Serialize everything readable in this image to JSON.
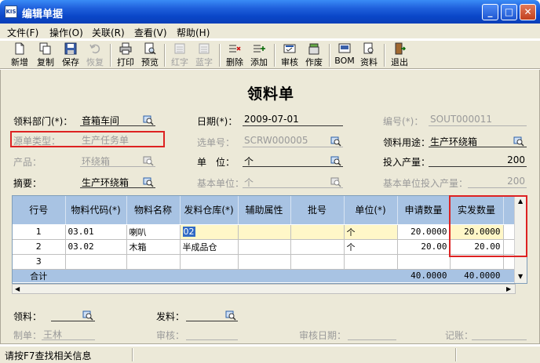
{
  "window": {
    "title": "编辑单据",
    "icon_text": "KIS",
    "buttons": [
      "minimize-icon",
      "maximize-icon",
      "close-icon"
    ]
  },
  "menu": [
    "文件(F)",
    "操作(O)",
    "关联(R)",
    "查看(V)",
    "帮助(H)"
  ],
  "toolbar": {
    "new": "新增",
    "copy": "复制",
    "save": "保存",
    "restore": "恢复",
    "print": "打印",
    "preview": "预览",
    "red": "红字",
    "blue": "蓝字",
    "delete": "删除",
    "add": "添加",
    "audit": "审核",
    "void": "作废",
    "bom": "BOM",
    "material": "资料",
    "exit": "退出"
  },
  "doc": {
    "title": "领料单",
    "dept_label": "领料部门(*)：",
    "dept_value": "音箱车间",
    "date_label": "日期(*)：",
    "date_value": "2009-07-01",
    "number_label": "编号(*)：",
    "number_value": "SOUT000011",
    "source_type_label": "源单类型：",
    "source_type_value": "生产任务单",
    "select_no_label": "选单号：",
    "select_no_value": "SCRW000005",
    "use_label": "领料用途：",
    "use_value": "生产环绕箱",
    "product_label": "产品：",
    "product_value": "环绕箱",
    "unit_label": "单　位：",
    "unit_value": "个",
    "input_qty_label": "投入产量：",
    "input_qty_value": "200",
    "summary_label": "摘要：",
    "summary_value": "生产环绕箱",
    "base_unit_label": "基本单位：",
    "base_unit_value": "个",
    "base_input_label": "基本单位投入产量：",
    "base_input_value": "200"
  },
  "grid": {
    "headers": [
      "行号",
      "物料代码(*)",
      "物料名称",
      "发料仓库(*)",
      "辅助属性",
      "批号",
      "单位(*)",
      "申请数量",
      "实发数量"
    ],
    "rows": [
      {
        "no": "1",
        "code": "03.01",
        "name": "喇叭",
        "warehouse": "02",
        "unit": "个",
        "req": "20.0000",
        "actual": "20.0000"
      },
      {
        "no": "2",
        "code": "03.02",
        "name": "木箱",
        "warehouse": "半成品仓",
        "unit": "个",
        "req": "20.00",
        "actual": "20.00"
      },
      {
        "no": "3",
        "code": "",
        "name": "",
        "warehouse": "",
        "unit": "",
        "req": "",
        "actual": ""
      }
    ],
    "total_label": "合计",
    "total_req": "40.0000",
    "total_actual": "40.0000"
  },
  "footer": {
    "picker_label": "领料：",
    "picker_value": "",
    "issuer_label": "发料：",
    "issuer_value": "",
    "maker_label": "制单：",
    "maker_value": "王林",
    "auditor_label": "审核：",
    "auditor_value": "",
    "audit_date_label": "审核日期：",
    "audit_date_value": "",
    "posted_label": "记账：",
    "posted_value": ""
  },
  "status": {
    "text": "请按F7查找相关信息"
  },
  "colors": {
    "title_bar": "#0a46c8",
    "grid_header": "#a8c3e3",
    "highlight_cell": "#fff7c8",
    "red_box": "#dd2222"
  }
}
